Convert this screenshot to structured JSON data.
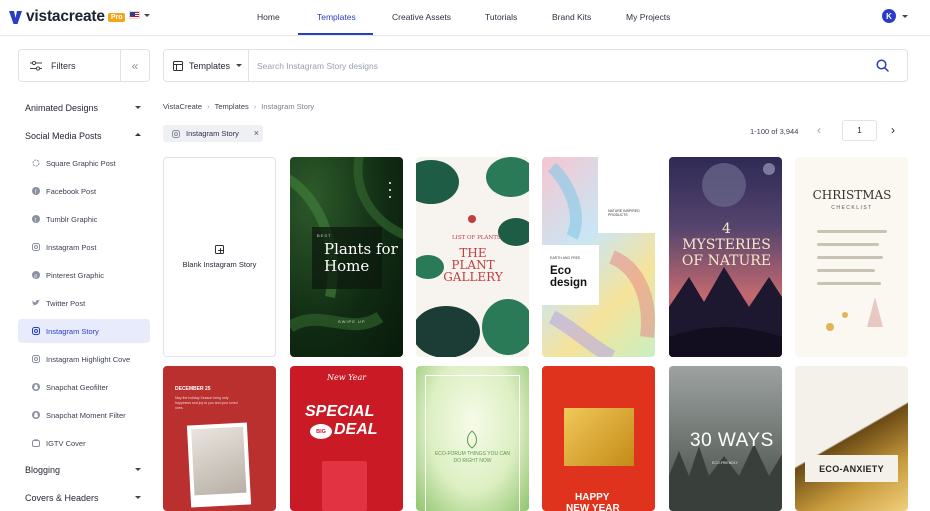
{
  "header": {
    "logo_text": "vistacreate",
    "pro_badge": "Pro",
    "nav": [
      {
        "label": "Home"
      },
      {
        "label": "Templates"
      },
      {
        "label": "Creative Assets"
      },
      {
        "label": "Tutorials"
      },
      {
        "label": "Brand Kits"
      },
      {
        "label": "My Projects"
      }
    ],
    "active_nav": "Templates",
    "avatar_initial": "K"
  },
  "sidebar": {
    "filters_label": "Filters",
    "sections": [
      {
        "label": "Animated Designs",
        "expanded": false
      },
      {
        "label": "Social Media Posts",
        "expanded": true
      },
      {
        "label": "Blogging",
        "expanded": false
      },
      {
        "label": "Covers & Headers",
        "expanded": false
      }
    ],
    "items": [
      {
        "label": "Square Graphic Post",
        "icon": "square-graphic-icon"
      },
      {
        "label": "Facebook Post",
        "icon": "facebook-icon"
      },
      {
        "label": "Tumblr Graphic",
        "icon": "tumblr-icon"
      },
      {
        "label": "Instagram Post",
        "icon": "instagram-icon"
      },
      {
        "label": "Pinterest Graphic",
        "icon": "pinterest-icon"
      },
      {
        "label": "Twitter Post",
        "icon": "twitter-icon"
      },
      {
        "label": "Instagram Story",
        "icon": "instagram-icon",
        "active": true
      },
      {
        "label": "Instagram Highlight Cove",
        "icon": "instagram-icon"
      },
      {
        "label": "Snapchat Geofilter",
        "icon": "snapchat-icon"
      },
      {
        "label": "Snapchat Moment Filter",
        "icon": "snapchat-icon"
      },
      {
        "label": "IGTV Cover",
        "icon": "igtv-icon"
      }
    ]
  },
  "search": {
    "category": "Templates",
    "placeholder": "Search Instagram Story designs",
    "value": ""
  },
  "breadcrumb": [
    "VistaCreate",
    "Templates",
    "Instagram Story"
  ],
  "filter_chip": "Instagram Story",
  "pagination": {
    "result_count": "1-100 of 3,944",
    "current_page": "1"
  },
  "blank_card_label": "Blank Instagram Story",
  "cards": {
    "plants_small": "BEST",
    "plants_title": "Plants for Home",
    "plants_swipe": "SWIPE UP",
    "gallery_small": "LIST OF PLANTS",
    "gallery_title": "THE PLANT GALLERY",
    "eco_small": "EARTH AND FREE",
    "eco_nature": "NATURE INSPIRED PRODUCTS",
    "eco_title": "Eco design",
    "mysteries_title": "4 MYSTERIES OF NATURE",
    "christmas_title": "CHRISTMAS",
    "christmas_sub": "CHECKLIST",
    "december_title": "DECEMBER 25",
    "december_text": "May the holiday Season bring only happiness and joy to you and your loved ones",
    "newyear_small": "New Year",
    "special": "SPECIAL",
    "big": "BIG",
    "deal": "DEAL",
    "ecoforum_text": "ECO-FORUM THINGS YOU CAN DO RIGHT NOW",
    "happy_line1": "HAPPY",
    "happy_line2": "NEW YEAR",
    "ways_title": "30 WAYS",
    "ways_small": "ECO-FRIENDLY",
    "anxiety_title": "ECO-ANXIETY"
  }
}
